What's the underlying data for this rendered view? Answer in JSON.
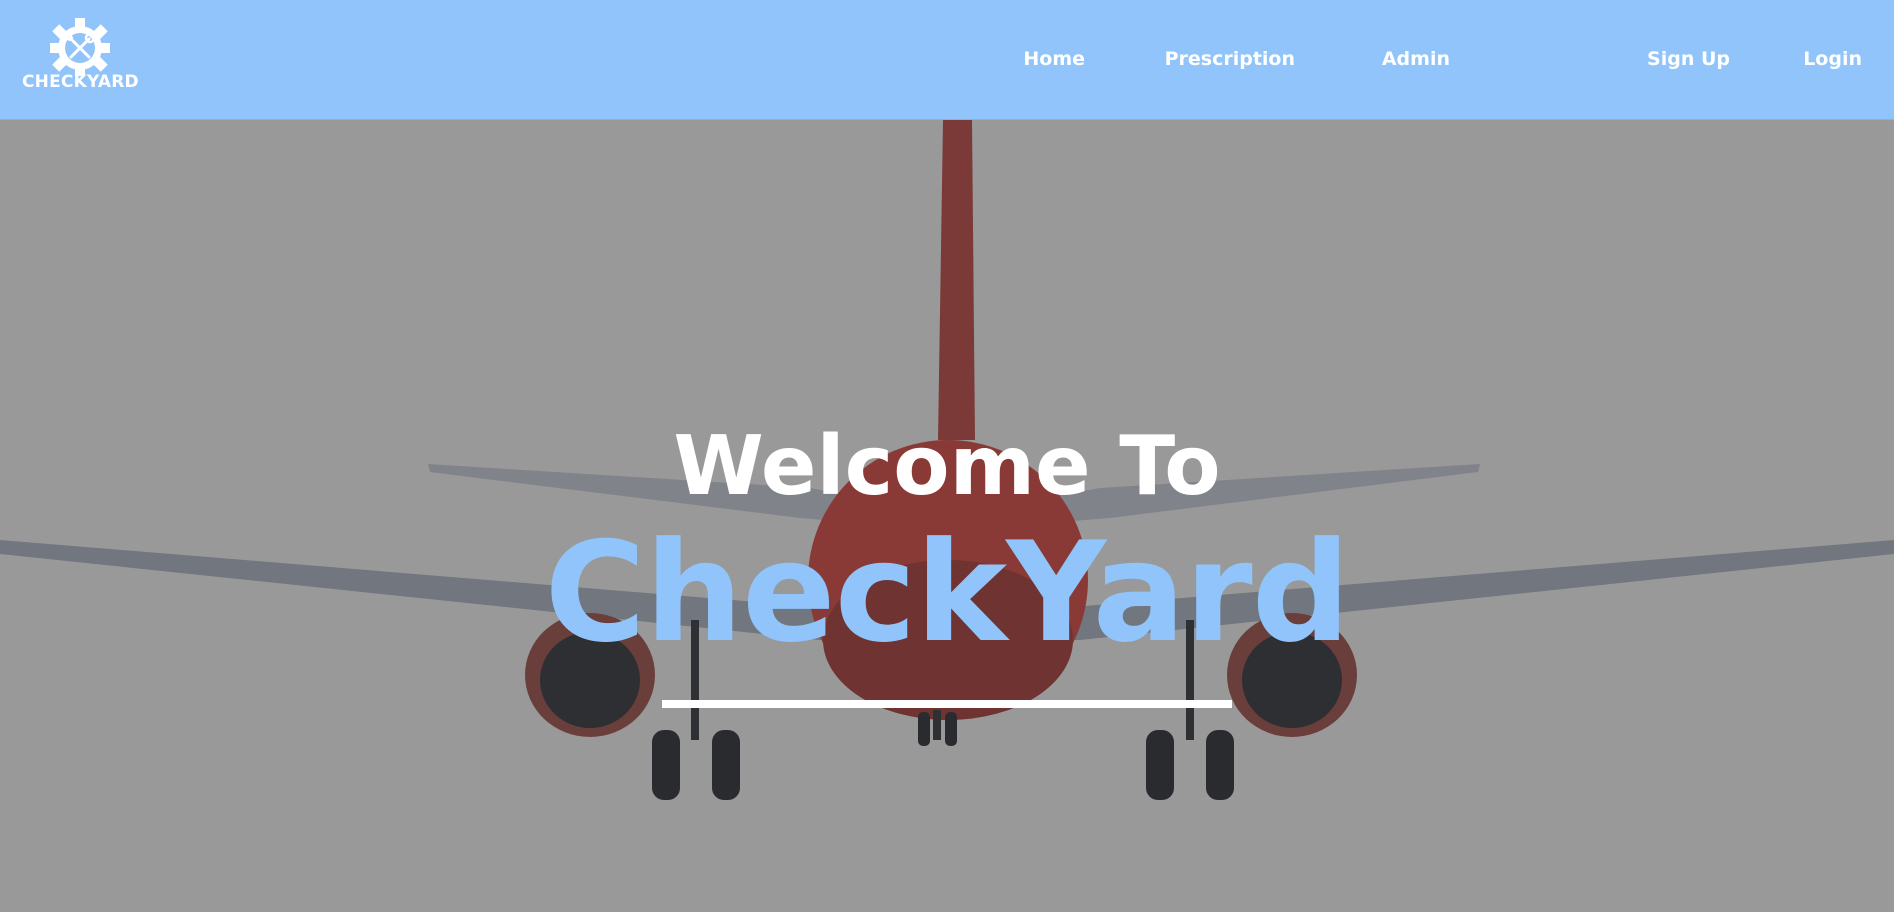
{
  "header": {
    "logo_text": "CHECKYARD",
    "logo_icon": "gear-wrench-icon",
    "nav": [
      {
        "label": "Home"
      },
      {
        "label": "Prescription"
      },
      {
        "label": "Admin"
      },
      {
        "label": "Sign Up"
      },
      {
        "label": "Login"
      }
    ]
  },
  "hero": {
    "welcome": "Welcome To",
    "brand": "CheckYard",
    "background": "airplane-rear-view-photo"
  },
  "colors": {
    "accent": "#90c4fa",
    "hero_overlay": "#999999",
    "text_light": "#ffffff"
  }
}
